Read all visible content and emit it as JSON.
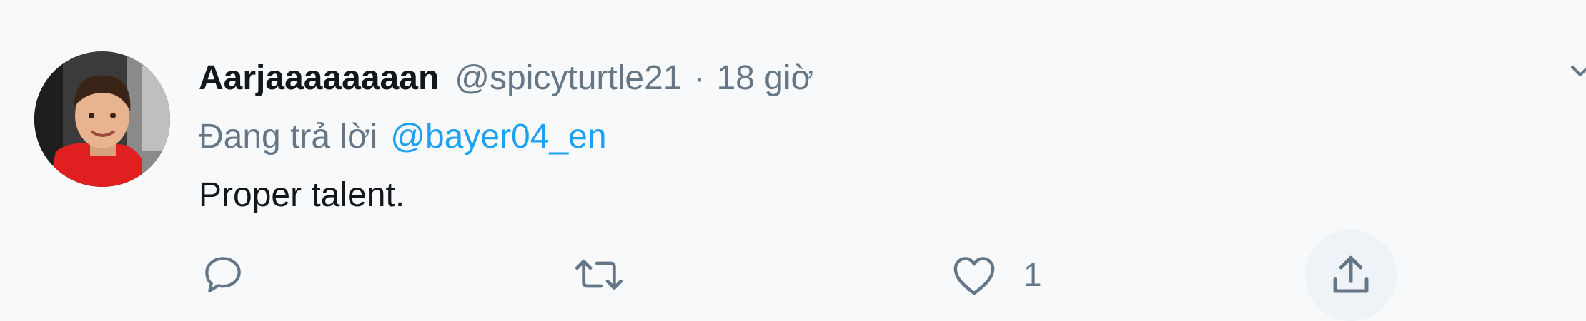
{
  "tweet": {
    "display_name": "Aarjaaaaaaaan",
    "handle": "@spicyturtle21",
    "separator": "·",
    "time": "18 giờ",
    "reply_prefix": "Đang trả lời",
    "reply_to": "@bayer04_en",
    "text": "Proper talent.",
    "like_count": "1"
  },
  "colors": {
    "background": "#f7f9fa",
    "text_primary": "#14171a",
    "text_secondary": "#657786",
    "link": "#1da1f2"
  },
  "icons": {
    "reply": "reply-icon",
    "retweet": "retweet-icon",
    "like": "heart-icon",
    "share": "share-icon",
    "caret": "chevron-down-icon"
  }
}
